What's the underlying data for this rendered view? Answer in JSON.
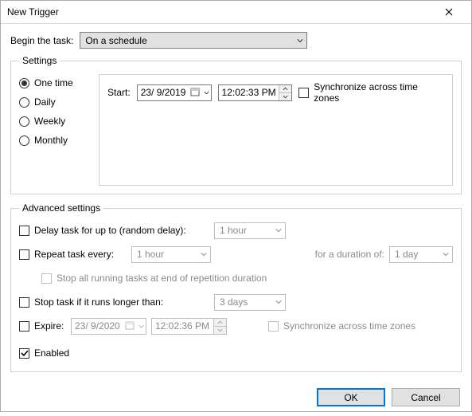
{
  "window": {
    "title": "New Trigger"
  },
  "begin": {
    "label": "Begin the task:",
    "value": "On a schedule"
  },
  "settings": {
    "legend": "Settings",
    "freq": {
      "one_time": "One time",
      "daily": "Daily",
      "weekly": "Weekly",
      "monthly": "Monthly",
      "selected": "one_time"
    },
    "start_label": "Start:",
    "start_date": "23/ 9/2019",
    "start_time": "12:02:33 PM",
    "sync_label": "Synchronize across time zones"
  },
  "advanced": {
    "legend": "Advanced settings",
    "delay_label": "Delay task for up to (random delay):",
    "delay_value": "1 hour",
    "repeat_label": "Repeat task every:",
    "repeat_value": "1 hour",
    "duration_label": "for a duration of:",
    "duration_value": "1 day",
    "stop_all_label": "Stop all running tasks at end of repetition duration",
    "stop_if_label": "Stop task if it runs longer than:",
    "stop_if_value": "3 days",
    "expire_label": "Expire:",
    "expire_date": "23/ 9/2020",
    "expire_time": "12:02:36 PM",
    "expire_sync_label": "Synchronize across time zones",
    "enabled_label": "Enabled"
  },
  "footer": {
    "ok": "OK",
    "cancel": "Cancel"
  }
}
